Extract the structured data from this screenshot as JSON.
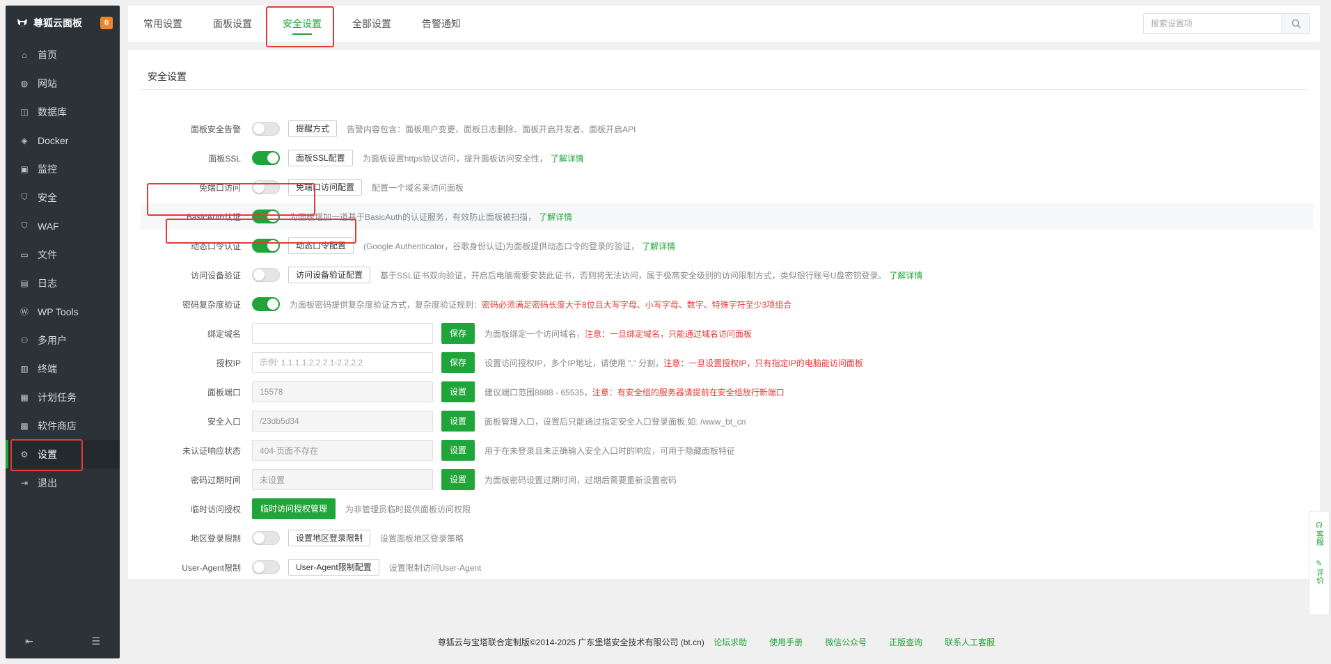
{
  "brand": {
    "name": "尊狐云面板",
    "badge": "0"
  },
  "sidebar": {
    "items": [
      {
        "label": "首页",
        "icon": "home-icon"
      },
      {
        "label": "网站",
        "icon": "globe-icon"
      },
      {
        "label": "数据库",
        "icon": "database-icon"
      },
      {
        "label": "Docker",
        "icon": "docker-icon"
      },
      {
        "label": "监控",
        "icon": "monitor-icon"
      },
      {
        "label": "安全",
        "icon": "shield-icon"
      },
      {
        "label": "WAF",
        "icon": "waf-shield-icon"
      },
      {
        "label": "文件",
        "icon": "folder-icon"
      },
      {
        "label": "日志",
        "icon": "log-icon"
      },
      {
        "label": "WP Tools",
        "icon": "wordpress-icon"
      },
      {
        "label": "多用户",
        "icon": "users-icon"
      },
      {
        "label": "终端",
        "icon": "terminal-icon"
      },
      {
        "label": "计划任务",
        "icon": "calendar-icon"
      },
      {
        "label": "软件商店",
        "icon": "apps-icon"
      },
      {
        "label": "设置",
        "icon": "gear-icon",
        "active": true
      },
      {
        "label": "退出",
        "icon": "logout-icon"
      }
    ]
  },
  "tabs": [
    "常用设置",
    "面板设置",
    "安全设置",
    "全部设置",
    "告警通知"
  ],
  "active_tab": "安全设置",
  "search": {
    "placeholder": "搜索设置项"
  },
  "panel": {
    "title": "安全设置"
  },
  "settings": {
    "alarm": {
      "label": "面板安全告警",
      "on": false,
      "button": "提醒方式",
      "desc": "告警内容包含：面板用户变更、面板日志删除、面板开启开发者、面板开启API"
    },
    "ssl": {
      "label": "面板SSL",
      "on": true,
      "button": "面板SSL配置",
      "desc": "为面板设置https协议访问，提升面板访问安全性，",
      "link": "了解详情"
    },
    "noport": {
      "label": "免端口访问",
      "on": false,
      "button": "免端口访问配置",
      "desc": "配置一个域名来访问面板"
    },
    "basicauth": {
      "label": "BasicAuth认证",
      "on": true,
      "desc": "为面板增加一道基于BasicAuth的认证服务，有效防止面板被扫描，",
      "link": "了解详情"
    },
    "totp": {
      "label": "动态口令认证",
      "on": true,
      "button": "动态口令配置",
      "desc": "(Google Authenticator，谷歌身份认证)为面板提供动态口令的登录的验证，",
      "link": "了解详情"
    },
    "device": {
      "label": "访问设备验证",
      "on": false,
      "button": "访问设备验证配置",
      "desc": "基于SSL证书双向验证，开启后电脑需要安装此证书，否则将无法访问，属于极高安全级别的访问限制方式，类似银行账号U盘密钥登录。",
      "link": "了解详情"
    },
    "pwd": {
      "label": "密码复杂度验证",
      "on": true,
      "desc": "为面板密码提供复杂度验证方式，复杂度验证规则：",
      "warn": "密码必须满足密码长度大于8位且大写字母、小写字母、数字、特殊字符至少3项组合"
    },
    "domain": {
      "label": "绑定域名",
      "value": "",
      "placeholder": "",
      "button": "保存",
      "desc": "为面板绑定一个访问域名，",
      "warn": "注意：一旦绑定域名，只能通过域名访问面板"
    },
    "ip": {
      "label": "授权IP",
      "value": "",
      "placeholder": "示例: 1.1.1.1,2.2.2.1-2.2.2.2",
      "button": "保存",
      "desc": "设置访问授权IP，多个IP地址，请使用 \",\" 分割，",
      "warn": "注意：一旦设置授权IP，只有指定IP的电脑能访问面板"
    },
    "port": {
      "label": "面板端口",
      "value": "15578",
      "button": "设置",
      "desc": "建议端口范围8888 - 65535，",
      "warn": "注意：有安全组的服务器请提前在安全组放行新端口"
    },
    "entry": {
      "label": "安全入口",
      "value": "/23db5d34",
      "button": "设置",
      "desc": "面板管理入口，设置后只能通过指定安全入口登录面板,如: /www_bt_cn"
    },
    "unauth": {
      "label": "未认证响应状态",
      "value": "404-页面不存在",
      "button": "设置",
      "desc": "用于在未登录且未正确输入安全入口时的响应，可用于隐藏面板特征"
    },
    "expire": {
      "label": "密码过期时间",
      "value": "未设置",
      "button": "设置",
      "desc": "为面板密码设置过期时间，过期后需要重新设置密码"
    },
    "temp": {
      "label": "临时访问授权",
      "button": "临时访问授权管理",
      "desc": "为非管理员临时提供面板访问权限"
    },
    "region": {
      "label": "地区登录限制",
      "on": false,
      "button": "设置地区登录限制",
      "desc": "设置面板地区登录策略"
    },
    "ua": {
      "label": "User-Agent限制",
      "on": false,
      "button": "User-Agent限制配置",
      "desc": "设置限制访问User-Agent"
    }
  },
  "footer": {
    "copyright": "尊狐云与宝塔联合定制版©2014-2025 广东堡塔安全技术有限公司 (bt.cn)",
    "links": [
      "论坛求助",
      "使用手册",
      "微信公众号",
      "正版查询",
      "联系人工客服"
    ]
  },
  "float": {
    "service": "客服",
    "review": "评价"
  },
  "colors": {
    "accent": "#20a53a",
    "sidebar": "#2c3338",
    "highlight": "#e53935",
    "warn": "#e53935"
  }
}
